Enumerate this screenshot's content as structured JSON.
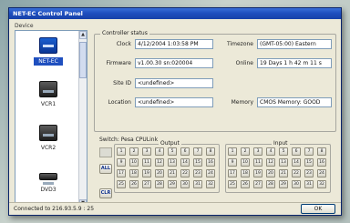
{
  "window": {
    "title": "NET-EC Control Panel"
  },
  "device_panel": {
    "label": "Device",
    "items": [
      {
        "label": "NET-EC",
        "icon": "network-device-icon",
        "selected": true
      },
      {
        "label": "VCR1",
        "icon": "vcr-icon"
      },
      {
        "label": "VCR2",
        "icon": "vcr-icon"
      },
      {
        "label": "DVD3",
        "icon": "dvd-icon"
      }
    ]
  },
  "controller_status": {
    "title": "Controller status",
    "clock_label": "Clock",
    "clock_value": "4/12/2004  1:03:58 PM",
    "timezone_label": "Timezone",
    "timezone_value": "(GMT-05:00) Eastern",
    "firmware_label": "Firmware",
    "firmware_value": "v1.00.30  sn:020004",
    "online_label": "Online",
    "online_value": "19 Days  1 h  42 m  11 s",
    "siteid_label": "Site ID",
    "siteid_value": "<undefined>",
    "location_label": "Location",
    "location_value": "<undefined>",
    "memory_label": "Memory",
    "memory_value": "CMOS Memory: GOOD"
  },
  "switch": {
    "label": "Switch: Pesa CPULink",
    "output_title": "Output",
    "input_title": "Input",
    "all_label": "ALL",
    "clr_label": "CLR",
    "output_buttons": [
      1,
      2,
      3,
      4,
      5,
      6,
      7,
      8,
      9,
      10,
      11,
      12,
      13,
      14,
      15,
      16,
      17,
      18,
      19,
      20,
      21,
      22,
      23,
      24,
      25,
      26,
      27,
      28,
      29,
      30,
      31,
      32
    ],
    "input_buttons": [
      1,
      2,
      3,
      4,
      5,
      6,
      7,
      8,
      9,
      10,
      11,
      12,
      13,
      14,
      15,
      16,
      17,
      18,
      19,
      20,
      21,
      22,
      23,
      24,
      25,
      26,
      27,
      28,
      29,
      30,
      31,
      32
    ]
  },
  "statusbar": {
    "text": "Connected to 216.93.5.9 : 25",
    "ok_label": "OK"
  }
}
